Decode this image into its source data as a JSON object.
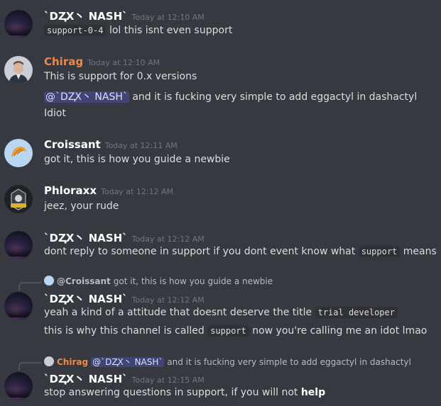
{
  "messages": [
    {
      "username": "`DⱫX丶 NASH`",
      "timestamp": "Today at 12:10 AM",
      "lines": [
        {
          "code": "support-0-4",
          "text": "lol this isnt even support"
        }
      ]
    },
    {
      "username": "Chirag",
      "timestamp": "Today at 12:10 AM",
      "lines": [
        {
          "text": "This is support for 0.x versions"
        },
        {
          "mention": "@`DⱫX丶 NASH`",
          "text": "and it is fucking very simple to add eggactyl in dashactyl"
        },
        {
          "text": "Idiot"
        }
      ]
    },
    {
      "username": "Croissant",
      "timestamp": "Today at 12:11 AM",
      "lines": [
        {
          "text": "got it, this is how you guide a newbie"
        }
      ]
    },
    {
      "username": "Phloraxx",
      "timestamp": "Today at 12:12 AM",
      "lines": [
        {
          "text": "jeez, your rude"
        }
      ]
    },
    {
      "username": "`DⱫX丶 NASH`",
      "timestamp": "Today at 12:12 AM",
      "lines": [
        {
          "pre": "dont reply to someone in support if you dont event know what",
          "code": "support",
          "post": "means"
        }
      ]
    },
    {
      "reply": {
        "name": "@Croissant",
        "text": "got it, this is how you guide a newbie"
      },
      "username": "`DⱫX丶 NASH`",
      "timestamp": "Today at 12:12 AM",
      "lines": [
        {
          "pre": "yeah a kind of a attitude that doesnt deserve the title",
          "code": "trial developer",
          "post": ""
        },
        {
          "pre": "this is why this channel is called",
          "code": "support",
          "post": "now you're calling me an idot lmao"
        }
      ]
    },
    {
      "reply": {
        "name": "Chirag",
        "mention": "@`DⱫX丶 NASH`",
        "text": "and it is fucking very simple to add eggactyl in dashactyl"
      },
      "username": "`DⱫX丶 NASH`",
      "timestamp": "Today at 12:15 AM",
      "lines": [
        {
          "pre": "stop answering questions in support, if you will not",
          "bold": "help"
        }
      ]
    }
  ]
}
